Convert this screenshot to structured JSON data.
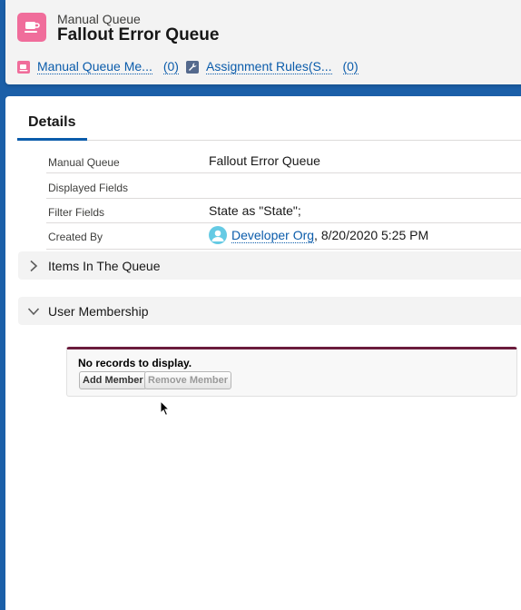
{
  "header": {
    "object_type": "Manual Queue",
    "title": "Fallout Error Queue",
    "related_links": [
      {
        "label": "Manual Queue Me...",
        "count": "(0)",
        "icon": "queue-icon",
        "icon_color": "#f06d9b"
      },
      {
        "label": "Assignment Rules(S...",
        "count": "(0)",
        "icon": "wrench-icon",
        "icon_color": "#54698d"
      }
    ]
  },
  "tabs": {
    "details_label": "Details"
  },
  "fields": [
    {
      "label": "Manual Queue",
      "value": "Fallout Error Queue"
    },
    {
      "label": "Displayed Fields",
      "value": ""
    },
    {
      "label": "Filter Fields",
      "value": "State as \"State\";"
    },
    {
      "label": "Created By",
      "owner": "Developer Org",
      "date": ", 8/20/2020 5:25 PM"
    }
  ],
  "sections": [
    {
      "label": "Items In The Queue",
      "state": "collapsed"
    },
    {
      "label": "User Membership",
      "state": "expanded"
    }
  ],
  "membership": {
    "empty_message": "No records to display.",
    "add_button": "Add Member",
    "remove_button": "Remove Member"
  },
  "colors": {
    "brand_blue": "#0b5cab",
    "app_icon_pink": "#f06d9b",
    "vf_accent": "#6b1c3c"
  }
}
